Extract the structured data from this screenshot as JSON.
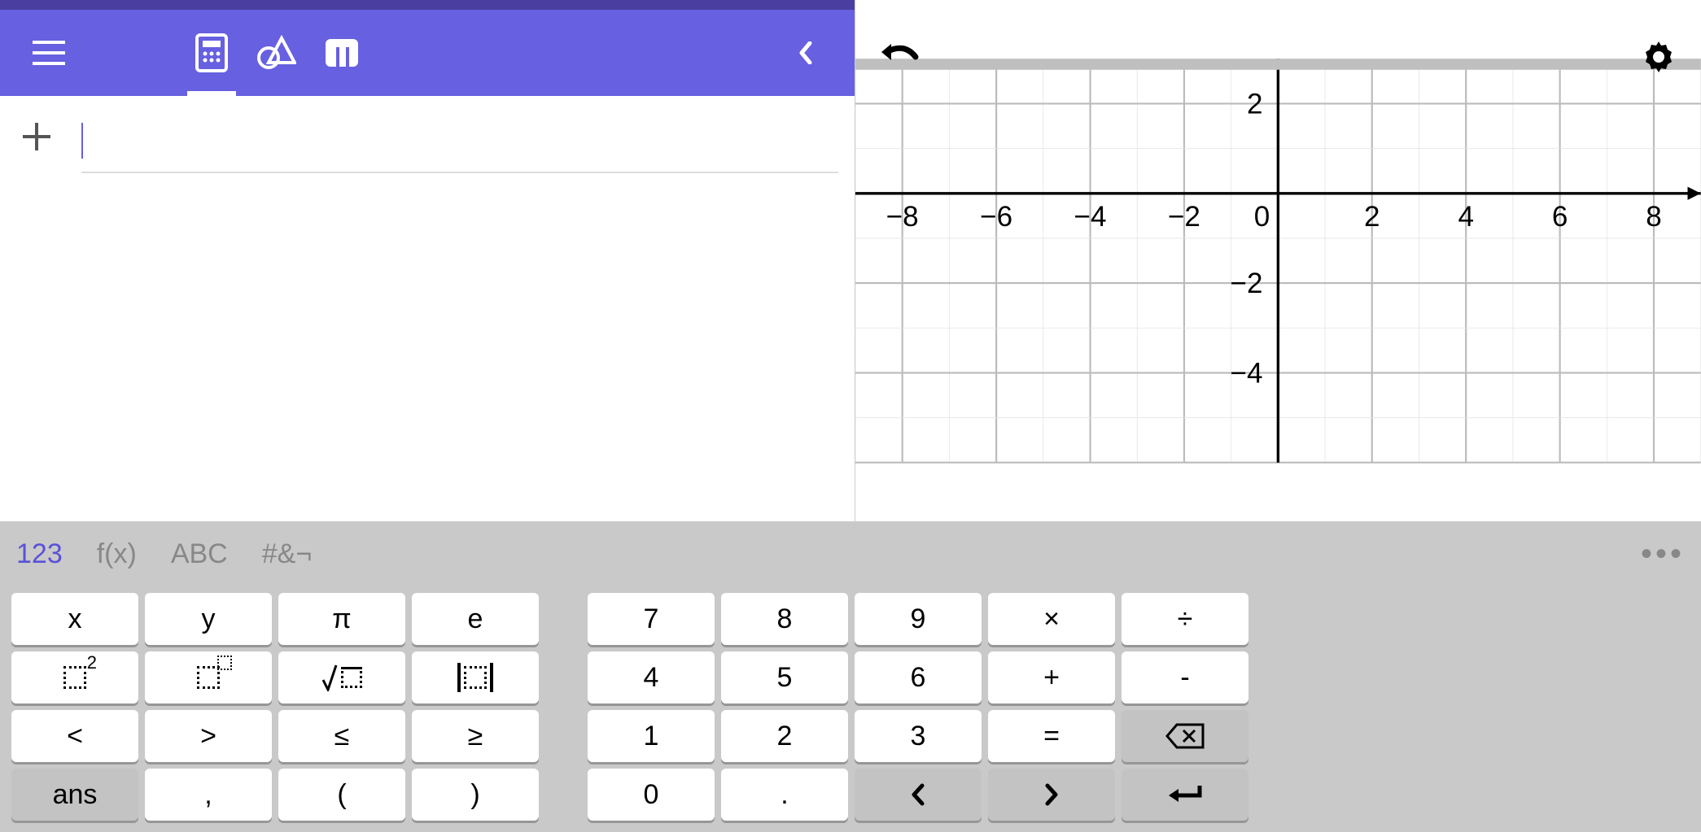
{
  "toolbar": {
    "views": [
      "algebra",
      "tools",
      "table"
    ],
    "active_view": "algebra"
  },
  "input": {
    "value": ""
  },
  "graph": {
    "x_ticks": [
      -8,
      -6,
      -4,
      -2,
      0,
      2,
      4,
      6,
      8
    ],
    "y_ticks": [
      2,
      -2,
      -4
    ],
    "x_range": [
      -9,
      9
    ],
    "y_range": [
      -6,
      3
    ]
  },
  "keyboard": {
    "tabs": {
      "numeric": "123",
      "functions": "f(x)",
      "letters": "ABC",
      "symbols": "#&¬"
    },
    "active_tab": "numeric",
    "left_keys": [
      [
        "x",
        "y",
        "π",
        "e"
      ],
      [
        "sq2",
        "sqn",
        "sqrt",
        "abs"
      ],
      [
        "<",
        ">",
        "≤",
        "≥"
      ],
      [
        "ans",
        ",",
        "(",
        ")"
      ]
    ],
    "right_keys": [
      [
        "7",
        "8",
        "9",
        "×",
        "÷"
      ],
      [
        "4",
        "5",
        "6",
        "+",
        "-"
      ],
      [
        "1",
        "2",
        "3",
        "=",
        "backspace"
      ],
      [
        "0",
        ".",
        "left",
        "right",
        "enter"
      ]
    ],
    "labels": {
      "x": "x",
      "y": "y",
      "π": "π",
      "e": "e",
      "<": "<",
      ">": ">",
      "≤": "≤",
      "≥": "≥",
      "ans": "ans",
      ",": ",",
      "(": "(",
      ")": ")",
      "7": "7",
      "8": "8",
      "9": "9",
      "×": "×",
      "÷": "÷",
      "4": "4",
      "5": "5",
      "6": "6",
      "+": "+",
      "-": "-",
      "1": "1",
      "2": "2",
      "3": "3",
      "=": "=",
      "0": "0",
      ".": ".",
      "left": "❮",
      "right": "❯"
    }
  }
}
